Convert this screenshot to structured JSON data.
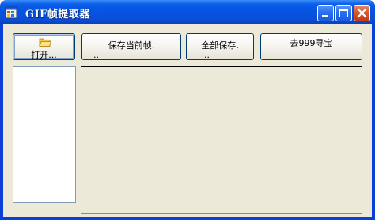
{
  "window": {
    "title": "GIF帧提取器"
  },
  "toolbar": {
    "open_label": "打开...",
    "save_current_label": "保存当前帧.",
    "save_current_label_cont": "..",
    "save_all_label": "全部保存.",
    "save_all_label_cont": "..",
    "goto_999_label": "去999寻宝"
  },
  "colors": {
    "titlebar": "#0554e3",
    "client_background": "#ece9d8",
    "button_border": "#003c74",
    "list_border": "#7f9db9"
  },
  "icons": {
    "app": "app-window-icon",
    "open": "folder-icon",
    "minimize": "minimize-icon",
    "maximize": "maximize-icon",
    "close": "close-icon"
  }
}
